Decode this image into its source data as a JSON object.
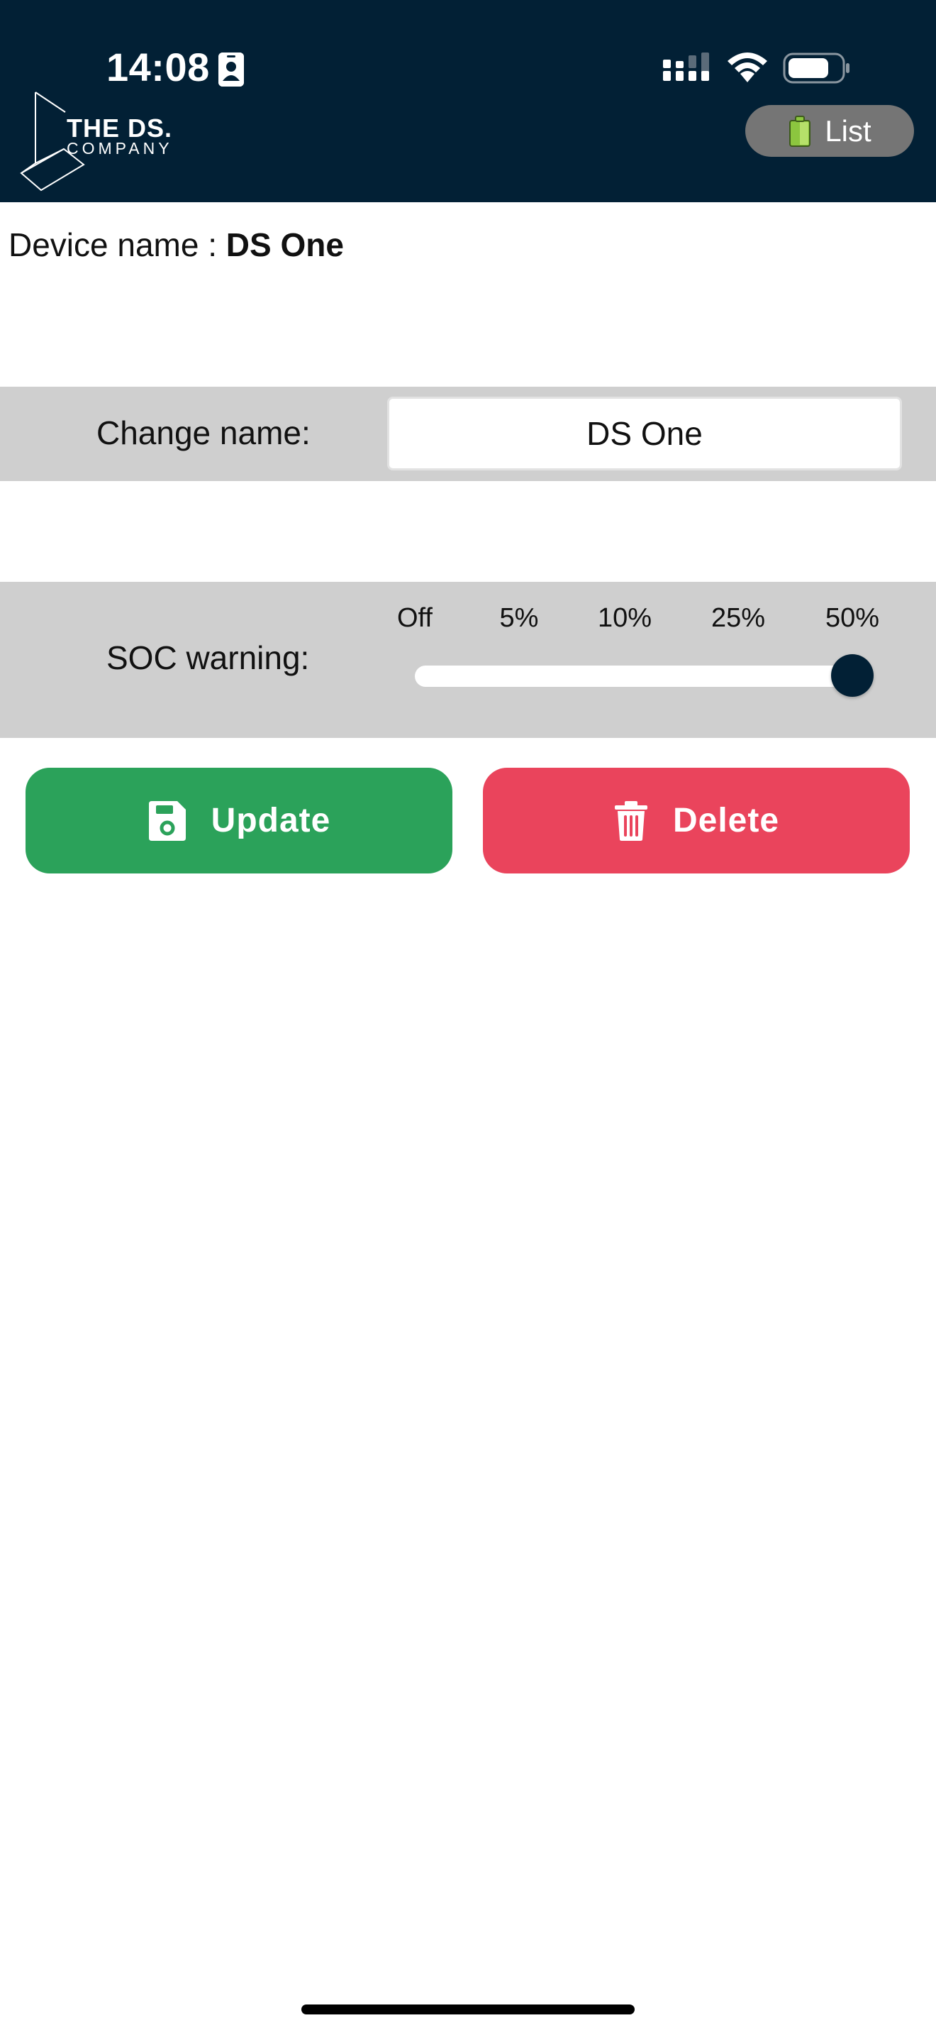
{
  "status_bar": {
    "time": "14:08",
    "icons": [
      "contact-card-icon",
      "cellular-signal-icon",
      "wifi-icon",
      "battery-icon"
    ]
  },
  "header": {
    "logo_main": "THE DS.",
    "logo_sub": "COMPANY",
    "list_button_label": "List",
    "list_button_icon": "battery-icon"
  },
  "device": {
    "name_label": "Device name : ",
    "name_value": "DS One"
  },
  "change_name": {
    "label": "Change name:",
    "value": "DS One"
  },
  "soc_warning": {
    "label": "SOC warning:",
    "options": [
      "Off",
      "5%",
      "10%",
      "25%",
      "50%"
    ],
    "selected": "50%",
    "selected_index": 4
  },
  "actions": {
    "update_label": "Update",
    "update_icon": "floppy-disk-icon",
    "delete_label": "Delete",
    "delete_icon": "trash-icon"
  },
  "colors": {
    "header_bg": "#022035",
    "band_bg": "#cfcfcf",
    "update_bg": "#2ba25a",
    "delete_bg": "#ea445c",
    "list_button_bg": "#757575",
    "battery_accent": "#8cc63f"
  }
}
